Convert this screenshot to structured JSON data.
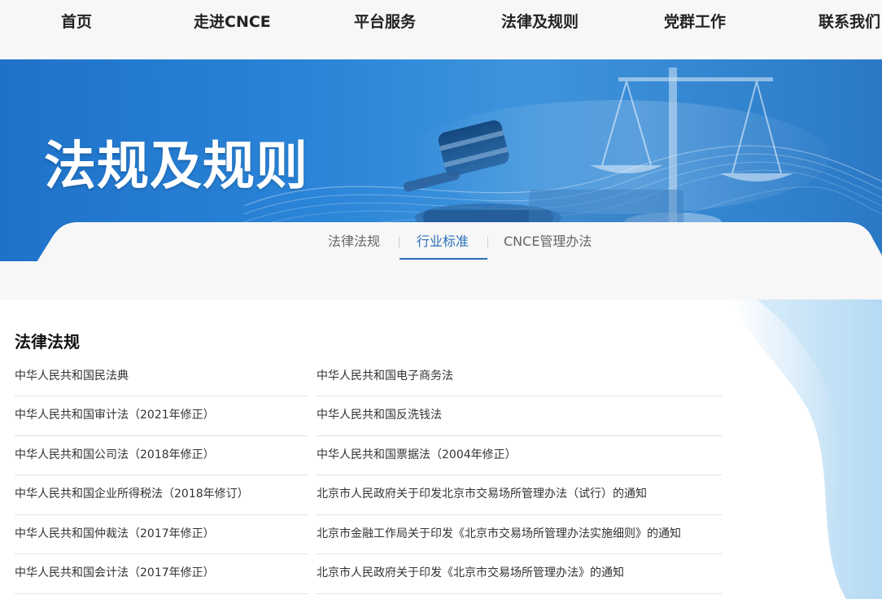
{
  "nav": {
    "items": [
      "首页",
      "走进CNCE",
      "平台服务",
      "法律及规则",
      "党群工作",
      "联系我们"
    ]
  },
  "banner": {
    "title": "法规及规则"
  },
  "subtabs": {
    "items": [
      "法律法规",
      "行业标准",
      "CNCE管理办法"
    ],
    "active_index": 1
  },
  "section": {
    "title": "法律法规"
  },
  "laws": {
    "left": [
      "中华人民共和国民法典",
      "中华人民共和国审计法（2021年修正）",
      "中华人民共和国公司法（2018年修正）",
      "中华人民共和国企业所得税法（2018年修订）",
      "中华人民共和国仲裁法（2017年修正）",
      "中华人民共和国会计法（2017年修正）"
    ],
    "right": [
      "中华人民共和国电子商务法",
      "中华人民共和国反洗钱法",
      "中华人民共和国票据法（2004年修正）",
      "北京市人民政府关于印发北京市交易场所管理办法（试行）的通知",
      "北京市金融工作局关于印发《北京市交易场所管理办法实施细则》的通知",
      "北京市人民政府关于印发《北京市交易场所管理办法》的通知"
    ]
  },
  "colors": {
    "accent": "#2a6fb8",
    "banner_blue": "#2a84d8",
    "nav_bg": "#f7f7f7"
  },
  "icons": {
    "banner_art": "scales-of-justice-and-gavel"
  }
}
